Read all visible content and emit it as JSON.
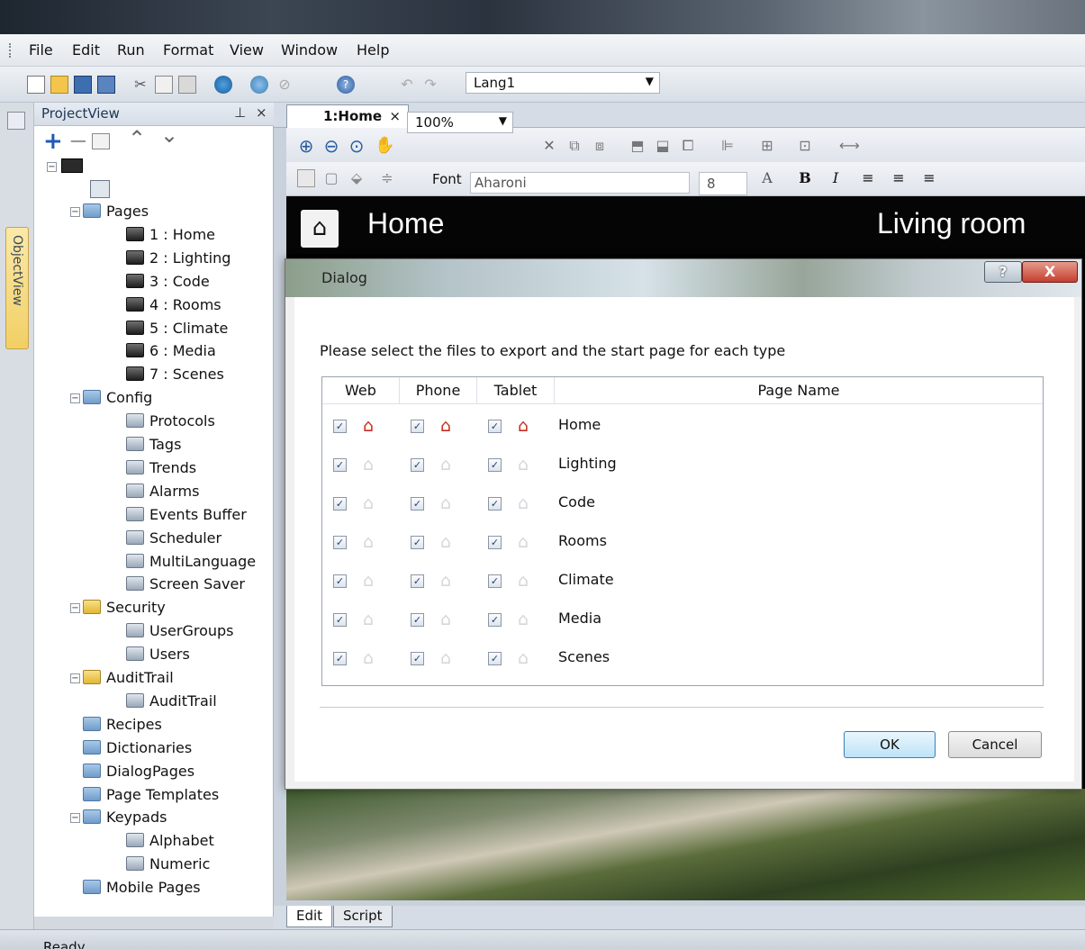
{
  "menu": [
    "File",
    "Edit",
    "Run",
    "Format",
    "View",
    "Window",
    "Help"
  ],
  "toolbar": {
    "language": "Lang1"
  },
  "object_view_label": "ObjectView",
  "project_view": {
    "title": "ProjectView",
    "pin_label": "ᙕ",
    "close_label": "×",
    "tree": [
      {
        "label": "Pages",
        "level": 1,
        "icon": "folder-icon"
      },
      {
        "label": "1 : Home",
        "level": 2,
        "icon": "page-icon"
      },
      {
        "label": "2 : Lighting",
        "level": 2,
        "icon": "page-icon"
      },
      {
        "label": "3 : Code",
        "level": 2,
        "icon": "page-icon"
      },
      {
        "label": "4 : Rooms",
        "level": 2,
        "icon": "page-icon"
      },
      {
        "label": "5 : Climate",
        "level": 2,
        "icon": "page-icon"
      },
      {
        "label": "6 : Media",
        "level": 2,
        "icon": "page-icon"
      },
      {
        "label": "7 : Scenes",
        "level": 2,
        "icon": "page-icon"
      },
      {
        "label": "Config",
        "level": 1,
        "icon": "folder-icon"
      },
      {
        "label": "Protocols",
        "level": 2,
        "icon": "protocols-icon"
      },
      {
        "label": "Tags",
        "level": 2,
        "icon": "tags-icon"
      },
      {
        "label": "Trends",
        "level": 2,
        "icon": "trends-icon"
      },
      {
        "label": "Alarms",
        "level": 2,
        "icon": "alarms-icon"
      },
      {
        "label": "Events Buffer",
        "level": 2,
        "icon": "events-buffer-icon"
      },
      {
        "label": "Scheduler",
        "level": 2,
        "icon": "scheduler-icon"
      },
      {
        "label": "MultiLanguage",
        "level": 2,
        "icon": "multilanguage-icon"
      },
      {
        "label": "Screen Saver",
        "level": 2,
        "icon": "screen-saver-icon"
      },
      {
        "label": "Security",
        "level": 1,
        "icon": "locked-folder-icon"
      },
      {
        "label": "UserGroups",
        "level": 2,
        "icon": "user-groups-icon"
      },
      {
        "label": "Users",
        "level": 2,
        "icon": "users-icon"
      },
      {
        "label": "AuditTrail",
        "level": 1,
        "icon": "locked-folder-icon"
      },
      {
        "label": "AuditTrail",
        "level": 2,
        "icon": "audit-trail-icon"
      },
      {
        "label": "Recipes",
        "level": 1,
        "icon": "folder-icon"
      },
      {
        "label": "Dictionaries",
        "level": 1,
        "icon": "folder-icon"
      },
      {
        "label": "DialogPages",
        "level": 1,
        "icon": "folder-icon"
      },
      {
        "label": "Page Templates",
        "level": 1,
        "icon": "folder-icon"
      },
      {
        "label": "Keypads",
        "level": 1,
        "icon": "folder-icon"
      },
      {
        "label": "Alphabet",
        "level": 2,
        "icon": "keypad-icon"
      },
      {
        "label": "Numeric",
        "level": 2,
        "icon": "keypad-icon"
      },
      {
        "label": "Mobile Pages",
        "level": 1,
        "icon": "folder-icon"
      }
    ]
  },
  "editor": {
    "tab": "1:Home",
    "tab_close": "×",
    "zoom": "100%",
    "font_label": "Font",
    "font_value": "Aharoni",
    "font_size": "8",
    "page_title": "Home",
    "page_right_title": "Living room",
    "bottom_tabs": [
      "Edit",
      "Script"
    ]
  },
  "dialog": {
    "title": "Dialog",
    "help_label": "?",
    "close_label": "X",
    "instruction": "Please select the files to export and the start page for each type",
    "columns": [
      "Web",
      "Phone",
      "Tablet",
      "Page Name"
    ],
    "rows": [
      {
        "name": "Home",
        "start": true
      },
      {
        "name": "Lighting",
        "start": false
      },
      {
        "name": "Code",
        "start": false
      },
      {
        "name": "Rooms",
        "start": false
      },
      {
        "name": "Climate",
        "start": false
      },
      {
        "name": "Media",
        "start": false
      },
      {
        "name": "Scenes",
        "start": false
      }
    ],
    "checked_mark": "✓",
    "home_glyph": "⌂",
    "ok_label": "OK",
    "cancel_label": "Cancel"
  },
  "status": "Ready",
  "colors": {
    "start_page": "#c62f22",
    "accent": "#3c7fb1"
  }
}
